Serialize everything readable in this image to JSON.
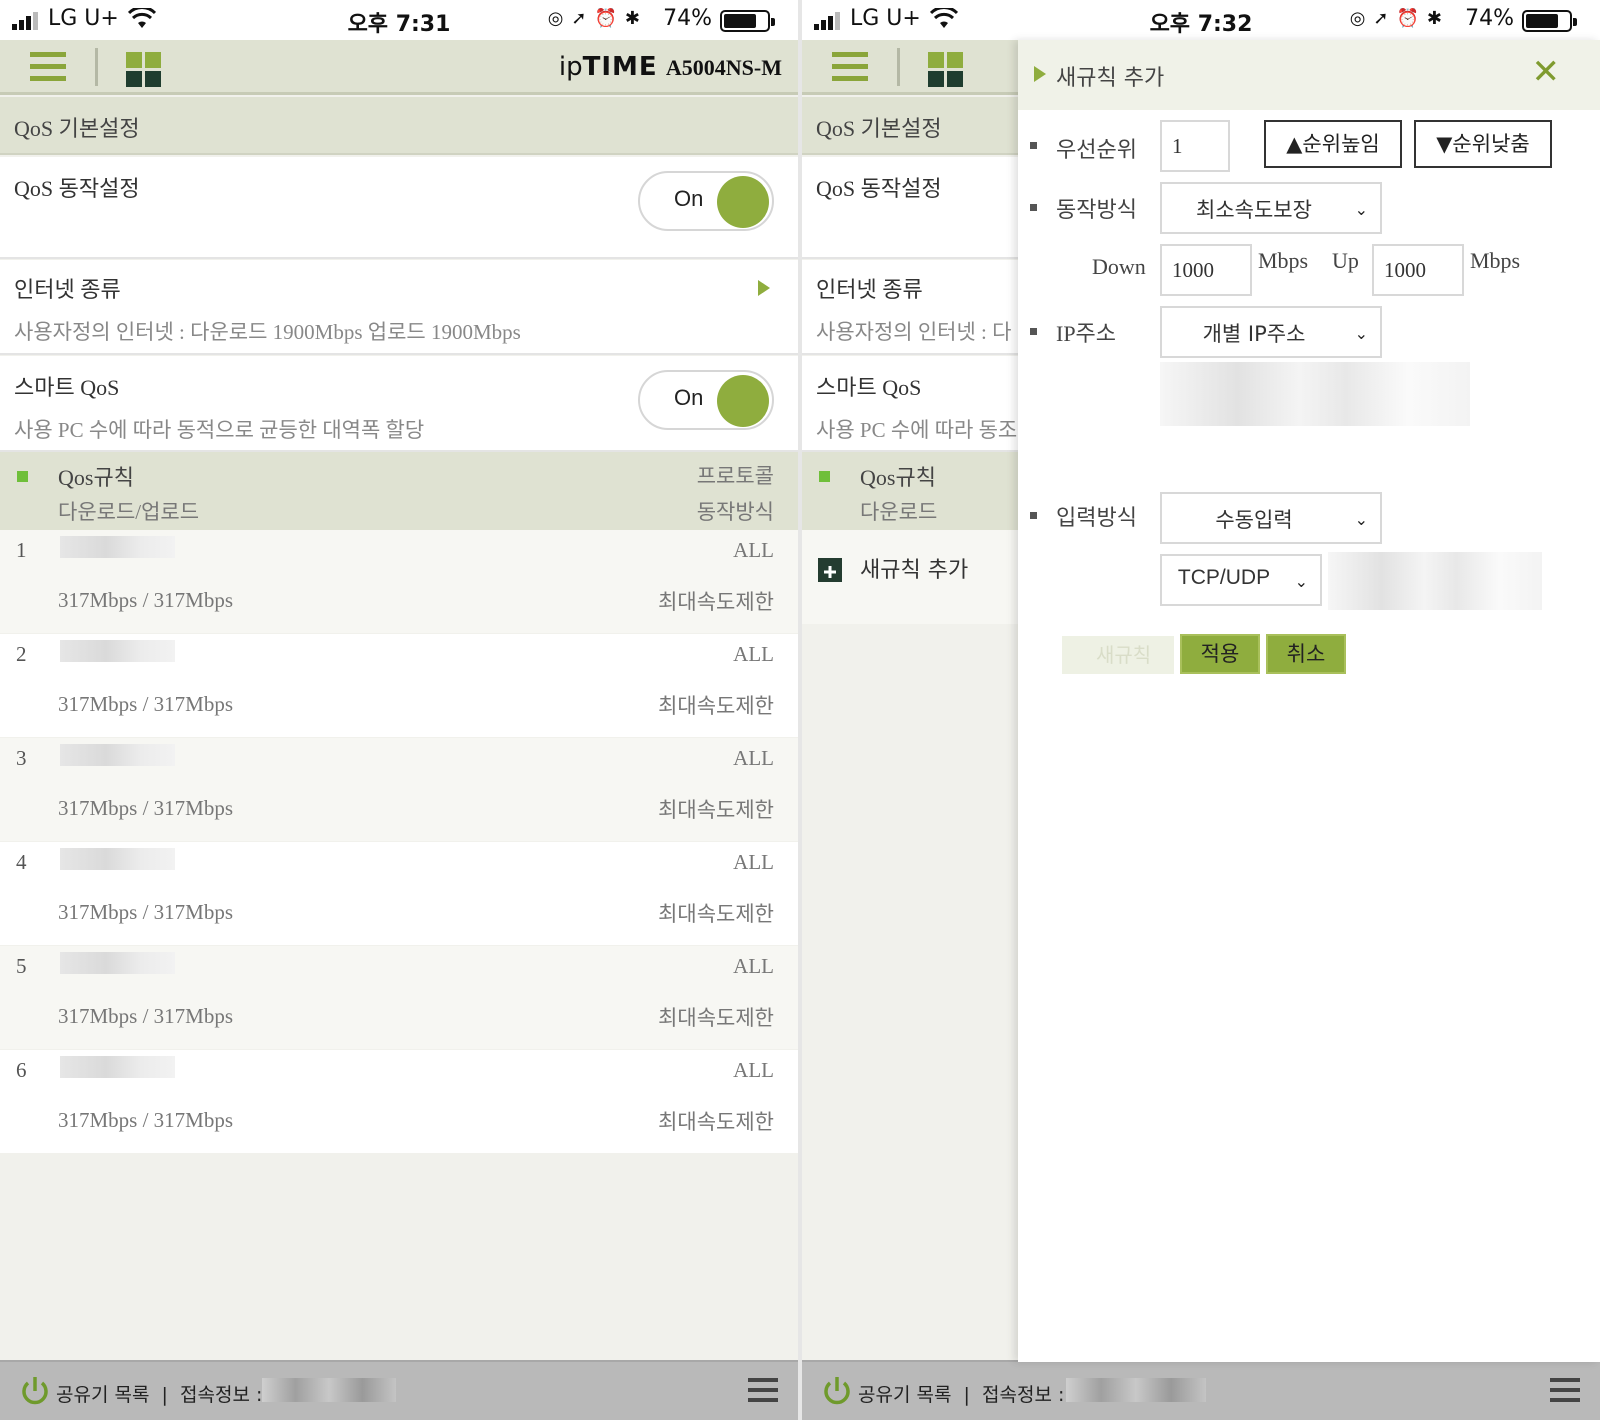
{
  "left": {
    "status": {
      "carrier": "LG U+",
      "time": "오후 7:31",
      "battery": "74%"
    },
    "header": {
      "brand_ip": "ip",
      "brand_time": "TIME",
      "brand_model": "A5004NS-M"
    },
    "section_title": "QoS 기본설정",
    "qos_operation": {
      "label": "QoS 동작설정",
      "toggle": "On"
    },
    "internet_type": {
      "label": "인터넷 종류",
      "desc": "사용자정의 인터넷 : 다운로드 1900Mbps 업로드 1900Mbps"
    },
    "smart_qos": {
      "label": "스마트 QoS",
      "desc": "사용 PC 수에 따라 동적으로 균등한 대역폭 할당",
      "toggle": "On"
    },
    "rules_header": {
      "col1": "Qos규칙",
      "col2": "다운로드/업로드",
      "col3": "프로토콜",
      "col4": "동작방식"
    },
    "rules": [
      {
        "num": "1",
        "protocol": "ALL",
        "rate": "317Mbps / 317Mbps",
        "mode": "최대속도제한"
      },
      {
        "num": "2",
        "protocol": "ALL",
        "rate": "317Mbps / 317Mbps",
        "mode": "최대속도제한"
      },
      {
        "num": "3",
        "protocol": "ALL",
        "rate": "317Mbps / 317Mbps",
        "mode": "최대속도제한"
      },
      {
        "num": "4",
        "protocol": "ALL",
        "rate": "317Mbps / 317Mbps",
        "mode": "최대속도제한"
      },
      {
        "num": "5",
        "protocol": "ALL",
        "rate": "317Mbps / 317Mbps",
        "mode": "최대속도제한"
      },
      {
        "num": "6",
        "protocol": "ALL",
        "rate": "317Mbps / 317Mbps",
        "mode": "최대속도제한"
      }
    ],
    "footer": {
      "routers": "공유기 목록",
      "sep": "|",
      "conn": "접속정보 :"
    }
  },
  "right": {
    "status": {
      "carrier": "LG U+",
      "time": "오후 7:32",
      "battery": "74%"
    },
    "section_title": "QoS 기본설정",
    "qos_operation_label": "QoS 동작설정",
    "internet_type": {
      "label": "인터넷 종류",
      "desc": "사용자정의 인터넷 : 다"
    },
    "smart_qos": {
      "label": "스마트 QoS",
      "desc": "사용 PC 수에 따라 동조"
    },
    "rules_header": {
      "col1": "Qos규칙",
      "col2": "다운로드"
    },
    "add_rule": "새규칙 추가",
    "footer": {
      "routers": "공유기 목록",
      "sep": "|",
      "conn": "접속정보 :"
    },
    "form": {
      "title": "새규칙 추가",
      "priority_label": "우선순위",
      "priority_value": "1",
      "raise_btn": "▲순위높임",
      "lower_btn": "▼순위낮춤",
      "mode_label": "동작방식",
      "mode_value": "최소속도보장",
      "down_label": "Down",
      "down_value": "1000",
      "down_unit": "Mbps",
      "up_label": "Up",
      "up_value": "1000",
      "up_unit": "Mbps",
      "ip_label": "IP주소",
      "ip_value": "개별 IP주소",
      "input_label": "입력방식",
      "input_value": "수동입력",
      "proto_value": "TCP/UDP",
      "new_rule_btn": "새규칙",
      "apply_btn": "적용",
      "cancel_btn": "취소"
    }
  },
  "colors": {
    "accent": "#8fad3e",
    "header_bg": "#dfe2d2",
    "footer_bg": "#b9b9b9"
  }
}
